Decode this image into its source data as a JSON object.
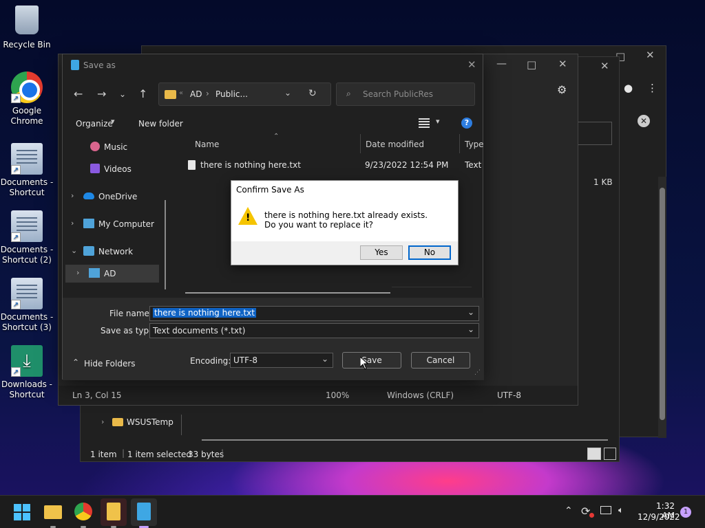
{
  "desktop": {
    "icons": [
      {
        "label": "Recycle Bin",
        "icon": "recycle-bin-icon"
      },
      {
        "label": "Google Chrome",
        "icon": "chrome-icon"
      },
      {
        "label": "Documents - Shortcut",
        "icon": "documents-shortcut-icon"
      },
      {
        "label": "Documents - Shortcut (2)",
        "icon": "documents-shortcut-icon"
      },
      {
        "label": "Documents - Shortcut (3)",
        "icon": "documents-shortcut-icon"
      },
      {
        "label": "Downloads - Shortcut",
        "icon": "downloads-shortcut-icon"
      }
    ]
  },
  "explorer_back": {
    "tree_item": "WSUSTemp",
    "file_size": "1 KB",
    "status": {
      "items": "1 item",
      "selected": "1 item selected",
      "size": "33 bytes"
    }
  },
  "notepad": {
    "status": {
      "position": "Ln 3, Col 15",
      "zoom": "100%",
      "line_ending": "Windows (CRLF)",
      "encoding": "UTF-8"
    }
  },
  "save_as": {
    "title": "Save as",
    "address": {
      "root": "AD",
      "separator": "›",
      "folder": "Public..."
    },
    "search_placeholder": "Search PublicRes",
    "toolbar": {
      "organize": "Organize",
      "new_folder": "New folder"
    },
    "tree": [
      {
        "label": "Music",
        "icon": "music-icon"
      },
      {
        "label": "Videos",
        "icon": "videos-icon"
      },
      {
        "label": "OneDrive",
        "icon": "onedrive-icon"
      },
      {
        "label": "My Computer",
        "icon": "computer-icon"
      },
      {
        "label": "Network",
        "icon": "network-icon"
      },
      {
        "label": "AD",
        "icon": "network-computer-icon"
      }
    ],
    "columns": {
      "name": "Name",
      "date": "Date modified",
      "type": "Type"
    },
    "files": [
      {
        "name": "there is nothing here.txt",
        "date": "9/23/2022 12:54 PM",
        "type": "Text D"
      }
    ],
    "form": {
      "file_name_label": "File name:",
      "file_name_value": "there is nothing here.txt",
      "save_type_label": "Save as type:",
      "save_type_value": "Text documents (*.txt)",
      "hide_folders": "Hide Folders",
      "encoding_label": "Encoding:",
      "encoding_value": "UTF-8",
      "save_label": "Save",
      "cancel_label": "Cancel"
    }
  },
  "confirm": {
    "title": "Confirm Save As",
    "line1": "there is nothing here.txt already exists.",
    "line2": "Do you want to replace it?",
    "yes": "Yes",
    "no": "No"
  },
  "taskbar": {
    "time": "1:32 AM",
    "date": "12/9/2022",
    "notification_count": "1"
  }
}
